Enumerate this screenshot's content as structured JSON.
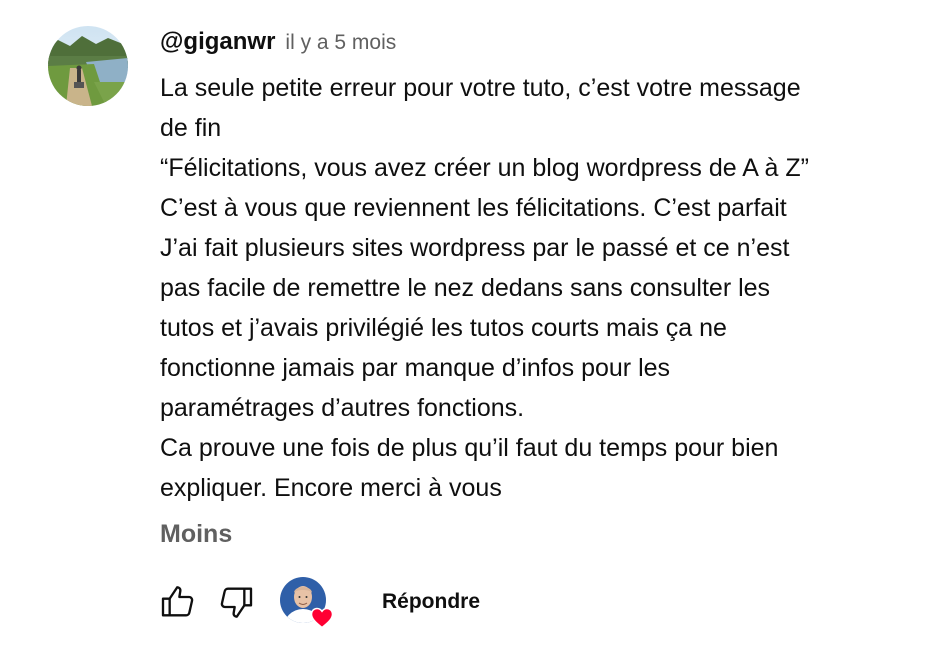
{
  "comment": {
    "author": "@giganwr",
    "time": "il y a 5 mois",
    "lines": [
      "La seule petite erreur pour votre tuto, c’est votre message",
      "de fin",
      "“Félicitations, vous avez créer un blog wordpress de A à Z”",
      "C’est à  vous que reviennent les félicitations. C’est parfait",
      "J’ai fait plusieurs sites wordpress par le passé et ce n’est",
      "pas facile de remettre le nez dedans sans consulter les",
      "tutos et j’avais privilégié les tutos courts mais ça ne",
      "fonctionne jamais par manque d’infos pour les",
      "paramétrages d’autres fonctions.",
      "Ca prouve une fois de plus qu’il faut du temps pour bien",
      "expliquer. Encore merci à vous"
    ],
    "less_label": "Moins"
  },
  "actions": {
    "reply_label": "Répondre",
    "like_icon": "thumb-up-icon",
    "dislike_icon": "thumb-down-icon",
    "heart_color": "#ff0033"
  }
}
